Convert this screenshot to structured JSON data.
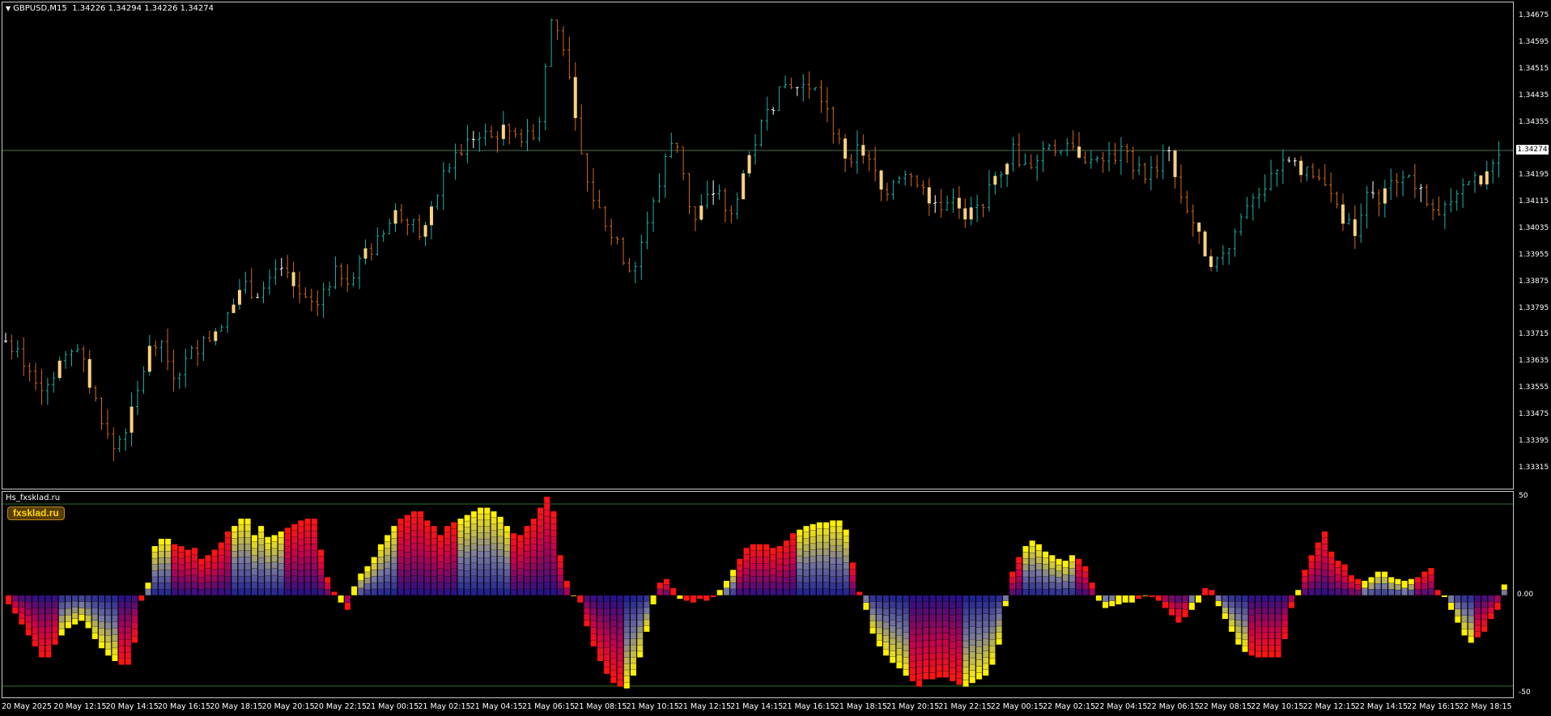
{
  "main_chart": {
    "symbol_timeframe": "GBPUSD,M15",
    "ohlc_readout": "1.34226 1.34294 1.34226 1.34274",
    "current_price": "1.34274",
    "price_min": 1.33275,
    "price_max": 1.34715,
    "price_ticks": [
      "1.34675",
      "1.34595",
      "1.34515",
      "1.34435",
      "1.34355",
      "1.34274",
      "1.34195",
      "1.34115",
      "1.34035",
      "1.33955",
      "1.33875",
      "1.33795",
      "1.33715",
      "1.33635",
      "1.33555",
      "1.33475",
      "1.33395",
      "1.33315"
    ],
    "colors": {
      "up": "#20b2aa",
      "down": "#d2691e",
      "doji": "#ffffff",
      "body_fill": "#ffd27f",
      "grid": "#2f4f2f"
    }
  },
  "indicator": {
    "name": "Hs_fxsklad.ru",
    "badge": "fxsklad.ru",
    "level_top": "50",
    "level_zero": "0.00",
    "level_bottom": "-50",
    "values": [
      -5,
      -10,
      -16,
      -22,
      -28,
      -34,
      -34,
      -27,
      -22,
      -18,
      -16,
      -14,
      -18,
      -24,
      -29,
      -33,
      -36,
      -38,
      -38,
      -26,
      -3,
      7,
      27,
      31,
      31,
      28,
      27,
      25,
      26,
      20,
      22,
      25,
      29,
      35,
      38,
      42,
      42,
      33,
      38,
      32,
      33,
      35,
      37,
      39,
      41,
      42,
      42,
      25,
      10,
      2,
      -4,
      -8,
      5,
      12,
      16,
      21,
      28,
      33,
      38,
      42,
      44,
      46,
      46,
      41,
      38,
      33,
      38,
      40,
      42,
      44,
      46,
      48,
      48,
      46,
      43,
      38,
      34,
      33,
      38,
      42,
      48,
      54,
      46,
      22,
      8,
      0,
      -4,
      -17,
      -28,
      -36,
      -43,
      -48,
      -50,
      -51,
      -44,
      -34,
      -20,
      -5,
      7,
      9,
      4,
      -2,
      -3,
      -4,
      -2,
      -3,
      -1,
      3,
      8,
      14,
      20,
      26,
      28,
      28,
      28,
      26,
      27,
      30,
      34,
      36,
      38,
      39,
      40,
      40,
      41,
      41,
      36,
      18,
      2,
      -8,
      -21,
      -28,
      -33,
      -37,
      -40,
      -44,
      -47,
      -50,
      -46,
      -46,
      -45,
      -45,
      -47,
      -49,
      -50,
      -48,
      -46,
      -44,
      -38,
      -27,
      -6,
      13,
      21,
      27,
      30,
      28,
      24,
      22,
      20,
      19,
      22,
      20,
      16,
      7,
      -3,
      -7,
      -6,
      -5,
      -4,
      -4,
      -2,
      0,
      -1,
      -3,
      -7,
      -11,
      -15,
      -12,
      -8,
      -4,
      4,
      3,
      -6,
      -13,
      -20,
      -27,
      -31,
      -33,
      -34,
      -34,
      -34,
      -34,
      -24,
      -7,
      3,
      14,
      22,
      29,
      35,
      24,
      19,
      17,
      11,
      9,
      8,
      10,
      13,
      13,
      10,
      9,
      8,
      9,
      10,
      13,
      15,
      3,
      -1,
      -8,
      -15,
      -22,
      -26,
      -23,
      -20,
      -13,
      -8,
      6
    ]
  },
  "time_axis": {
    "labels": [
      "20 May 2025",
      "20 May 12:15",
      "20 May 14:15",
      "20 May 16:15",
      "20 May 18:15",
      "20 May 20:15",
      "20 May 22:15",
      "21 May 00:15",
      "21 May 02:15",
      "21 May 04:15",
      "21 May 06:15",
      "21 May 08:15",
      "21 May 10:15",
      "21 May 12:15",
      "21 May 14:15",
      "21 May 16:15",
      "21 May 18:15",
      "21 May 20:15",
      "21 May 22:15",
      "22 May 00:15",
      "22 May 02:15",
      "22 May 04:15",
      "22 May 06:15",
      "22 May 08:15",
      "22 May 10:15",
      "22 May 12:15",
      "22 May 14:15",
      "22 May 16:15",
      "22 May 18:15"
    ]
  },
  "chart_data": {
    "type": "candlestick",
    "title": "GBPUSD,M15",
    "ylim": [
      1.33275,
      1.34715
    ],
    "close_path": [
      1.337,
      1.3366,
      1.3361,
      1.3357,
      1.336,
      1.3366,
      1.3369,
      1.3358,
      1.3348,
      1.3337,
      1.3343,
      1.3352,
      1.3367,
      1.3372,
      1.336,
      1.3363,
      1.3368,
      1.337,
      1.3375,
      1.3379,
      1.3388,
      1.3384,
      1.3386,
      1.3391,
      1.3388,
      1.3383,
      1.3379,
      1.3387,
      1.3391,
      1.3389,
      1.3395,
      1.3398,
      1.3403,
      1.3409,
      1.3407,
      1.3402,
      1.3409,
      1.3421,
      1.3425,
      1.343,
      1.3433,
      1.3431,
      1.3434,
      1.3433,
      1.3431,
      1.3435,
      1.3467,
      1.3461,
      1.3437,
      1.3418,
      1.341,
      1.3403,
      1.3396,
      1.3391,
      1.3405,
      1.3414,
      1.3432,
      1.3425,
      1.3405,
      1.3412,
      1.3416,
      1.3405,
      1.3418,
      1.3428,
      1.3437,
      1.3443,
      1.3448,
      1.3446,
      1.3447,
      1.3442,
      1.3432,
      1.3425,
      1.3428,
      1.3424,
      1.3414,
      1.3419,
      1.3422,
      1.3418,
      1.3413,
      1.3411,
      1.3415,
      1.3407,
      1.341,
      1.3415,
      1.3422,
      1.3428,
      1.3422,
      1.3425,
      1.343,
      1.3427,
      1.3428,
      1.3426,
      1.3423,
      1.3425,
      1.3427,
      1.3424,
      1.342,
      1.3422,
      1.3428,
      1.3415,
      1.3408,
      1.3398,
      1.3393,
      1.3397,
      1.3405,
      1.3414,
      1.3416,
      1.3419,
      1.3425,
      1.3422,
      1.342,
      1.3418,
      1.3413,
      1.3406,
      1.3403,
      1.3418,
      1.3413,
      1.3417,
      1.3422,
      1.3415,
      1.3413,
      1.341,
      1.3411,
      1.3415,
      1.3418,
      1.342,
      1.3425
    ]
  }
}
